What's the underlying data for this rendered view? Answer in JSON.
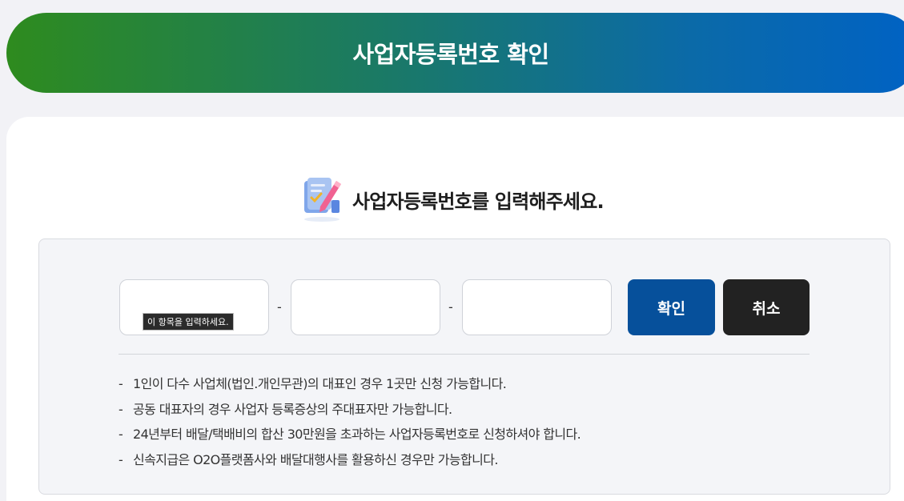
{
  "banner": {
    "title": "사업자등록번호 확인"
  },
  "form": {
    "heading": "사업자등록번호를 입력해주세요.",
    "heading_icon": "document-pencil-icon",
    "fields": [
      {
        "value": "",
        "placeholder": ""
      },
      {
        "value": "",
        "placeholder": ""
      },
      {
        "value": "",
        "placeholder": ""
      }
    ],
    "separator": "-",
    "validation_tooltip": "이 항목을 입력하세요.",
    "confirm_label": "확인",
    "cancel_label": "취소"
  },
  "notes": {
    "bullet": "-",
    "items": [
      "1인이 다수 사업체(법인.개인무관)의 대표인 경우 1곳만 신청 가능합니다.",
      "공동 대표자의 경우 사업자 등록증상의 주대표자만 가능합니다.",
      "24년부터 배달/택배비의 합산 30만원을 초과하는 사업자등록번호로 신청하셔야 합니다.",
      "신속지급은 O2O플랫폼사와 배달대행사를 활용하신 경우만 가능합니다."
    ]
  },
  "colors": {
    "banner_gradient_start": "#2e8b1e",
    "banner_gradient_end": "#0062c4",
    "confirm_button": "#06509b",
    "cancel_button": "#222222"
  }
}
